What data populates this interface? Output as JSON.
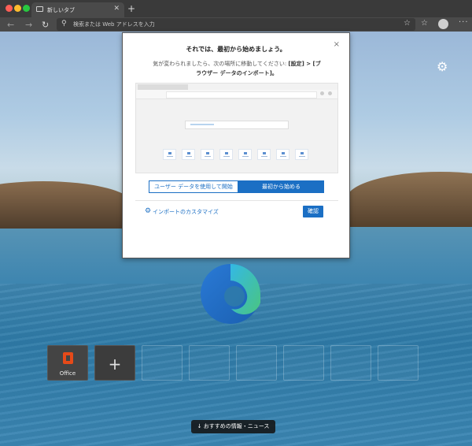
{
  "tab": {
    "label": "新しいタブ",
    "close": "✕",
    "new_tab": "+"
  },
  "toolbar": {
    "back": "←",
    "forward": "→",
    "refresh": "↻",
    "address_placeholder": "検索または Web アドレスを入力",
    "favorite": "☆",
    "favorites_bar": "☆"
  },
  "menu_dots": "···",
  "settings_gear": "⚙",
  "dialog": {
    "close": "×",
    "title": "それでは、最初から始めましょう。",
    "desc_plain": "気が変わられましたら、次の場所に移動してください: ",
    "desc_bold": "[設定] > [ブラウザー データのインポート]。",
    "option_import": "ユーザー データを使用して開始",
    "option_fresh": "最初から始める",
    "customize_link": "インポートのカスタマイズ",
    "ok_button": "確認"
  },
  "tiles": [
    {
      "label": "Office"
    },
    {
      "label": "+"
    }
  ],
  "news_button": "↓ おすすめの情報・ニュース",
  "colors": {
    "accent": "#1b6fc4",
    "office": "#e64a19"
  }
}
